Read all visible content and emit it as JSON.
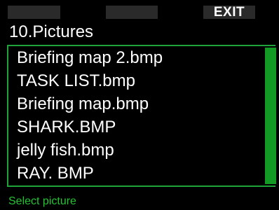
{
  "softkeys": {
    "left_label": "",
    "middle_label": "",
    "right_label": "EXIT"
  },
  "header": {
    "title": "10.Pictures"
  },
  "picture_list": {
    "items": [
      {
        "label": "Briefing map 2.bmp"
      },
      {
        "label": "TASK LIST.bmp"
      },
      {
        "label": "Briefing map.bmp"
      },
      {
        "label": "SHARK.BMP"
      },
      {
        "label": "jelly fish.bmp"
      },
      {
        "label": "RAY. BMP"
      }
    ],
    "scroll_fraction_visible": 1.0
  },
  "status": {
    "hint": "Select picture"
  },
  "colors": {
    "background": "#000000",
    "text": "#ffffff",
    "accent_green": "#129a24",
    "status_green": "#24c233",
    "softkey_background": "#2a2a2a"
  }
}
